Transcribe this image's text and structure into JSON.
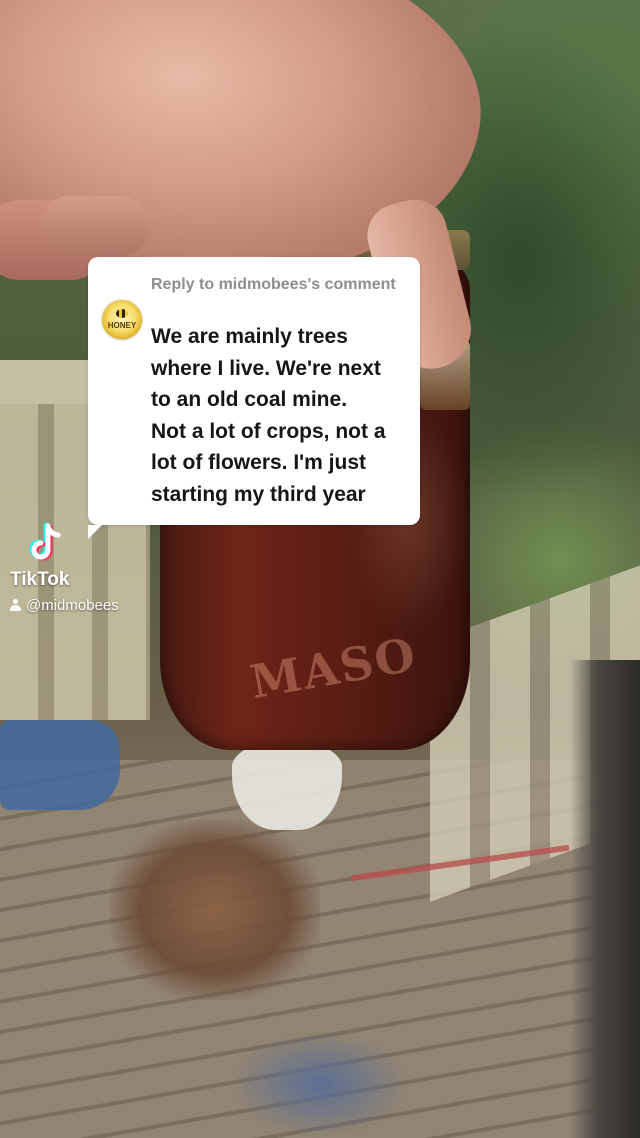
{
  "reply": {
    "header": "Reply to midmobees's comment",
    "avatar_label": "HONEY",
    "text": "We are mainly trees\nwhere I live. We're next\nto an old coal mine.\nNot a lot of crops, not a\nlot of flowers. I'm just\nstarting my third year"
  },
  "watermark": {
    "app_name": "TikTok",
    "handle": "@midmobees",
    "logo_icon": "tiktok-note-icon",
    "user_icon": "person-icon"
  },
  "photo": {
    "jar_emboss": "MASO",
    "jar_color": "#5a1d12"
  }
}
